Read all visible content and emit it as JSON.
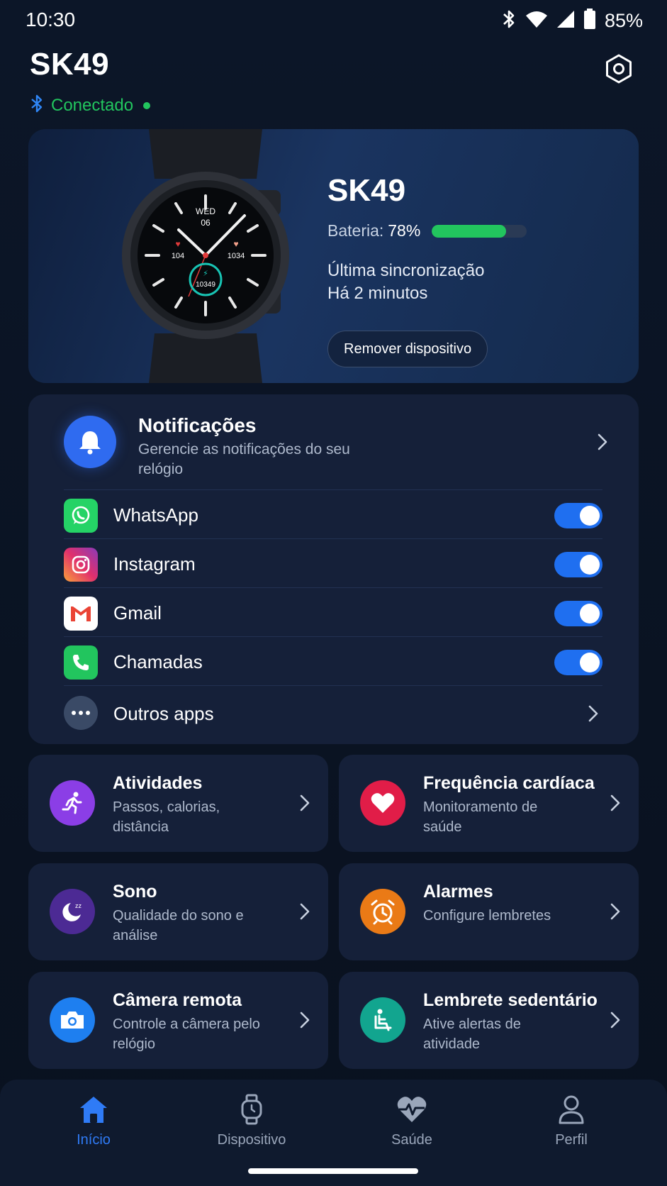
{
  "status_bar": {
    "time": "10:30",
    "battery": "85%"
  },
  "header": {
    "title": "SK49",
    "connection": "Conectado"
  },
  "device": {
    "name": "SK49",
    "battery_label": "Bateria:",
    "battery_value": "78%",
    "battery_level": 0.78,
    "sync_label": "Última sincronização",
    "sync_value": "Há 2 minutos",
    "remove_label": "Remover dispositivo",
    "watch_face": {
      "day": "WED",
      "date": "06",
      "heart_rate": "104",
      "calories": "1034",
      "steps": "10349"
    }
  },
  "notifications": {
    "title": "Notificações",
    "subtitle": "Gerencie as notificações do seu relógio",
    "apps": [
      {
        "label": "WhatsApp",
        "enabled": true,
        "icon": "whatsapp-icon",
        "color": "#25d366"
      },
      {
        "label": "Instagram",
        "enabled": true,
        "icon": "instagram-icon",
        "color": "#d62976"
      },
      {
        "label": "Gmail",
        "enabled": true,
        "icon": "gmail-icon",
        "color": "#ea4335"
      },
      {
        "label": "Chamadas",
        "enabled": true,
        "icon": "phone-icon",
        "color": "#22c55e"
      }
    ],
    "others_label": "Outros apps"
  },
  "features": [
    {
      "title": "Atividades",
      "subtitle": "Passos, calorias, distância",
      "icon": "running-icon",
      "color": "#8b3ee6"
    },
    {
      "title": "Frequência cardíaca",
      "subtitle": "Monitoramento de saúde",
      "icon": "heart-icon",
      "color": "#e11d48"
    },
    {
      "title": "Sono",
      "subtitle": "Qualidade do sono e análise",
      "icon": "moon-icon",
      "color": "#4c2a94"
    },
    {
      "title": "Alarmes",
      "subtitle": "Configure lembretes",
      "icon": "alarm-icon",
      "color": "#ea7a16"
    },
    {
      "title": "Câmera remota",
      "subtitle": "Controle a câmera pelo relógio",
      "icon": "camera-icon",
      "color": "#1e7ff0"
    },
    {
      "title": "Lembrete sedentário",
      "subtitle": "Ative alertas de atividade",
      "icon": "seated-person-icon",
      "color": "#12a58f"
    }
  ],
  "nav": {
    "items": [
      {
        "label": "Início",
        "icon": "home-icon",
        "active": true
      },
      {
        "label": "Dispositivo",
        "icon": "watch-icon",
        "active": false
      },
      {
        "label": "Saúde",
        "icon": "health-icon",
        "active": false
      },
      {
        "label": "Perfil",
        "icon": "profile-icon",
        "active": false
      }
    ]
  },
  "colors": {
    "accent": "#1f6ff0",
    "connected": "#22c55e",
    "battery": "#22c55e"
  }
}
